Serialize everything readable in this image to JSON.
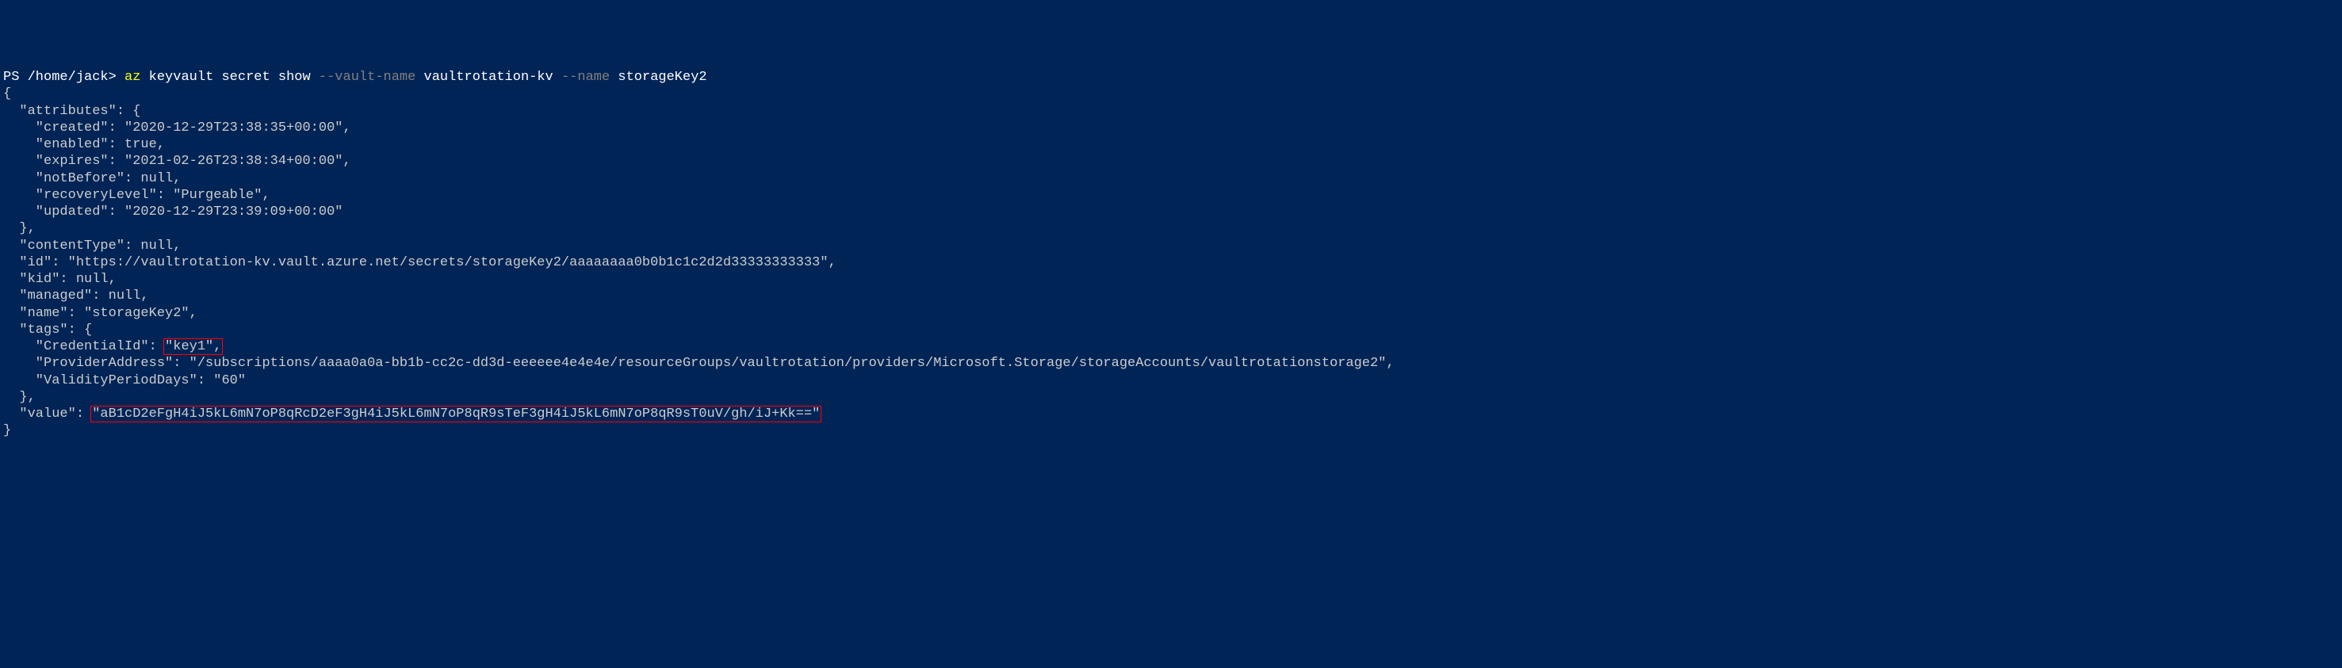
{
  "prompt": {
    "ps": "PS ",
    "path": "/home/jack",
    "gt": "> ",
    "cmd": "az ",
    "subcmd": "keyvault secret show ",
    "param1": "--vault-name ",
    "val1": "vaultrotation-kv ",
    "param2": "--name ",
    "val2": "storageKey2"
  },
  "output": {
    "l1": "{",
    "l2": "  \"attributes\": {",
    "l3": "    \"created\": \"2020-12-29T23:38:35+00:00\",",
    "l4": "    \"enabled\": true,",
    "l5": "    \"expires\": \"2021-02-26T23:38:34+00:00\",",
    "l6": "    \"notBefore\": null,",
    "l7": "    \"recoveryLevel\": \"Purgeable\",",
    "l8": "    \"updated\": \"2020-12-29T23:39:09+00:00\"",
    "l9": "  },",
    "l10": "  \"contentType\": null,",
    "l11": "  \"id\": \"https://vaultrotation-kv.vault.azure.net/secrets/storageKey2/aaaaaaaa0b0b1c1c2d2d33333333333\",",
    "l12": "  \"kid\": null,",
    "l13": "  \"managed\": null,",
    "l14": "  \"name\": \"storageKey2\",",
    "l15": "  \"tags\": {",
    "l16a": "    \"CredentialId\": ",
    "l16b": "\"key1\",",
    "l17": "    \"ProviderAddress\": \"/subscriptions/aaaa0a0a-bb1b-cc2c-dd3d-eeeeee4e4e4e/resourceGroups/vaultrotation/providers/Microsoft.Storage/storageAccounts/vaultrotationstorage2\",",
    "l18": "    \"ValidityPeriodDays\": \"60\"",
    "l19": "  },",
    "l20a": "  \"value\": ",
    "l20b": "\"aB1cD2eFgH4iJ5kL6mN7oP8qRcD2eF3gH4iJ5kL6mN7oP8qR9sTeF3gH4iJ5kL6mN7oP8qR9sT0uV/gh/iJ+Kk==\"",
    "l21": "}"
  }
}
